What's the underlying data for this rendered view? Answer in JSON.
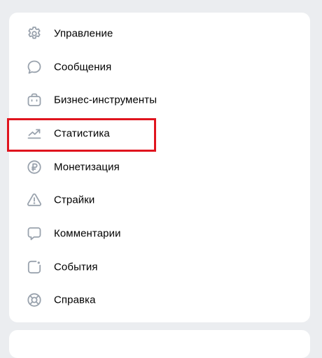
{
  "menu": {
    "items": [
      {
        "label": "Управление",
        "icon": "gear-icon"
      },
      {
        "label": "Сообщения",
        "icon": "message-bubble-icon"
      },
      {
        "label": "Бизнес-инструменты",
        "icon": "briefcase-icon"
      },
      {
        "label": "Статистика",
        "icon": "trend-chart-icon"
      },
      {
        "label": "Монетизация",
        "icon": "ruble-coin-icon"
      },
      {
        "label": "Страйки",
        "icon": "warning-triangle-icon"
      },
      {
        "label": "Комментарии",
        "icon": "comment-icon"
      },
      {
        "label": "События",
        "icon": "event-square-icon"
      },
      {
        "label": "Справка",
        "icon": "lifebuoy-icon"
      }
    ]
  },
  "highlight": {
    "target": "Статистика",
    "color": "#e0141e"
  },
  "colors": {
    "icon": "#99a2ad",
    "background": "#ebedf0",
    "card": "#ffffff"
  }
}
